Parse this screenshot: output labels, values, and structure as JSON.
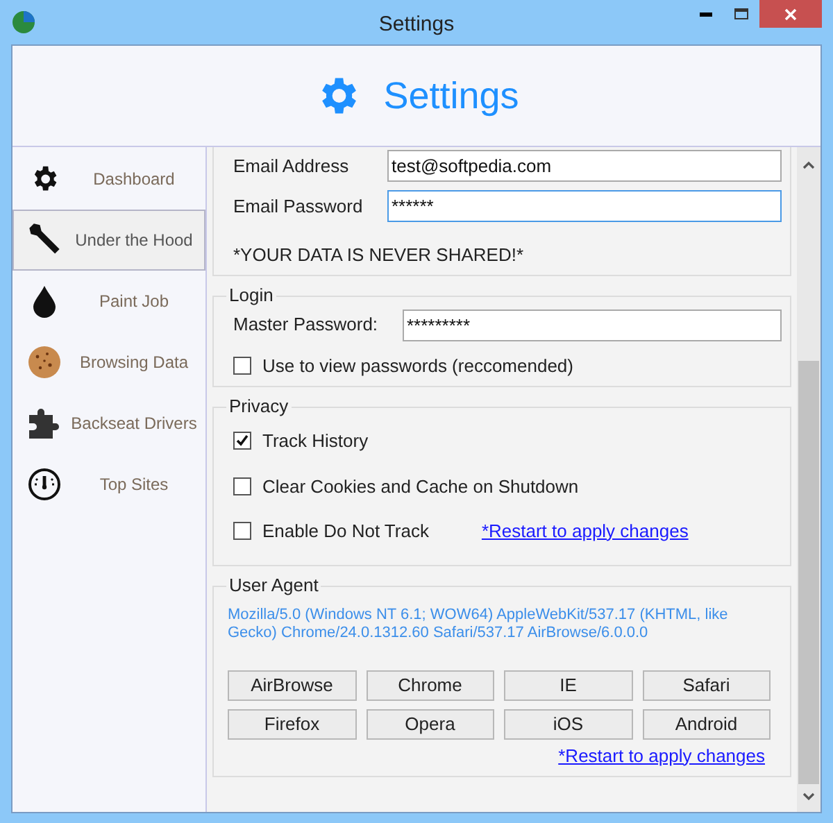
{
  "window": {
    "title": "Settings"
  },
  "header": {
    "title": "Settings"
  },
  "sidebar": {
    "items": [
      {
        "label": "Dashboard",
        "selected": false
      },
      {
        "label": "Under the Hood",
        "selected": true
      },
      {
        "label": "Paint Job",
        "selected": false
      },
      {
        "label": "Browsing Data",
        "selected": false
      },
      {
        "label": "Backseat Drivers",
        "selected": false
      },
      {
        "label": "Top Sites",
        "selected": false
      }
    ]
  },
  "email": {
    "fields": [
      {
        "label": "Email Address",
        "value": "test@softpedia.com",
        "focused": false
      },
      {
        "label": "Email Password",
        "value": "******",
        "focused": true
      }
    ],
    "note": "*YOUR DATA IS NEVER SHARED!*"
  },
  "login": {
    "legend": "Login",
    "field": {
      "label": "Master Password:",
      "value": "*********",
      "focused": false
    },
    "checkbox": {
      "label": "Use to view passwords (reccomended)",
      "checked": false
    }
  },
  "privacy": {
    "legend": "Privacy",
    "checkboxes": [
      {
        "label": "Track History",
        "checked": true
      },
      {
        "label": "Clear Cookies and Cache on Shutdown",
        "checked": false
      },
      {
        "label": "Enable Do Not Track",
        "checked": false
      }
    ],
    "link": "*Restart to apply changes"
  },
  "user_agent": {
    "legend": "User Agent",
    "value": "Mozilla/5.0 (Windows NT 6.1; WOW64) AppleWebKit/537.17 (KHTML, like Gecko) Chrome/24.0.1312.60 Safari/537.17 AirBrowse/6.0.0.0",
    "buttons": [
      "AirBrowse",
      "Chrome",
      "IE",
      "Safari",
      "Firefox",
      "Opera",
      "iOS",
      "Android"
    ],
    "link": "*Restart to apply changes"
  }
}
